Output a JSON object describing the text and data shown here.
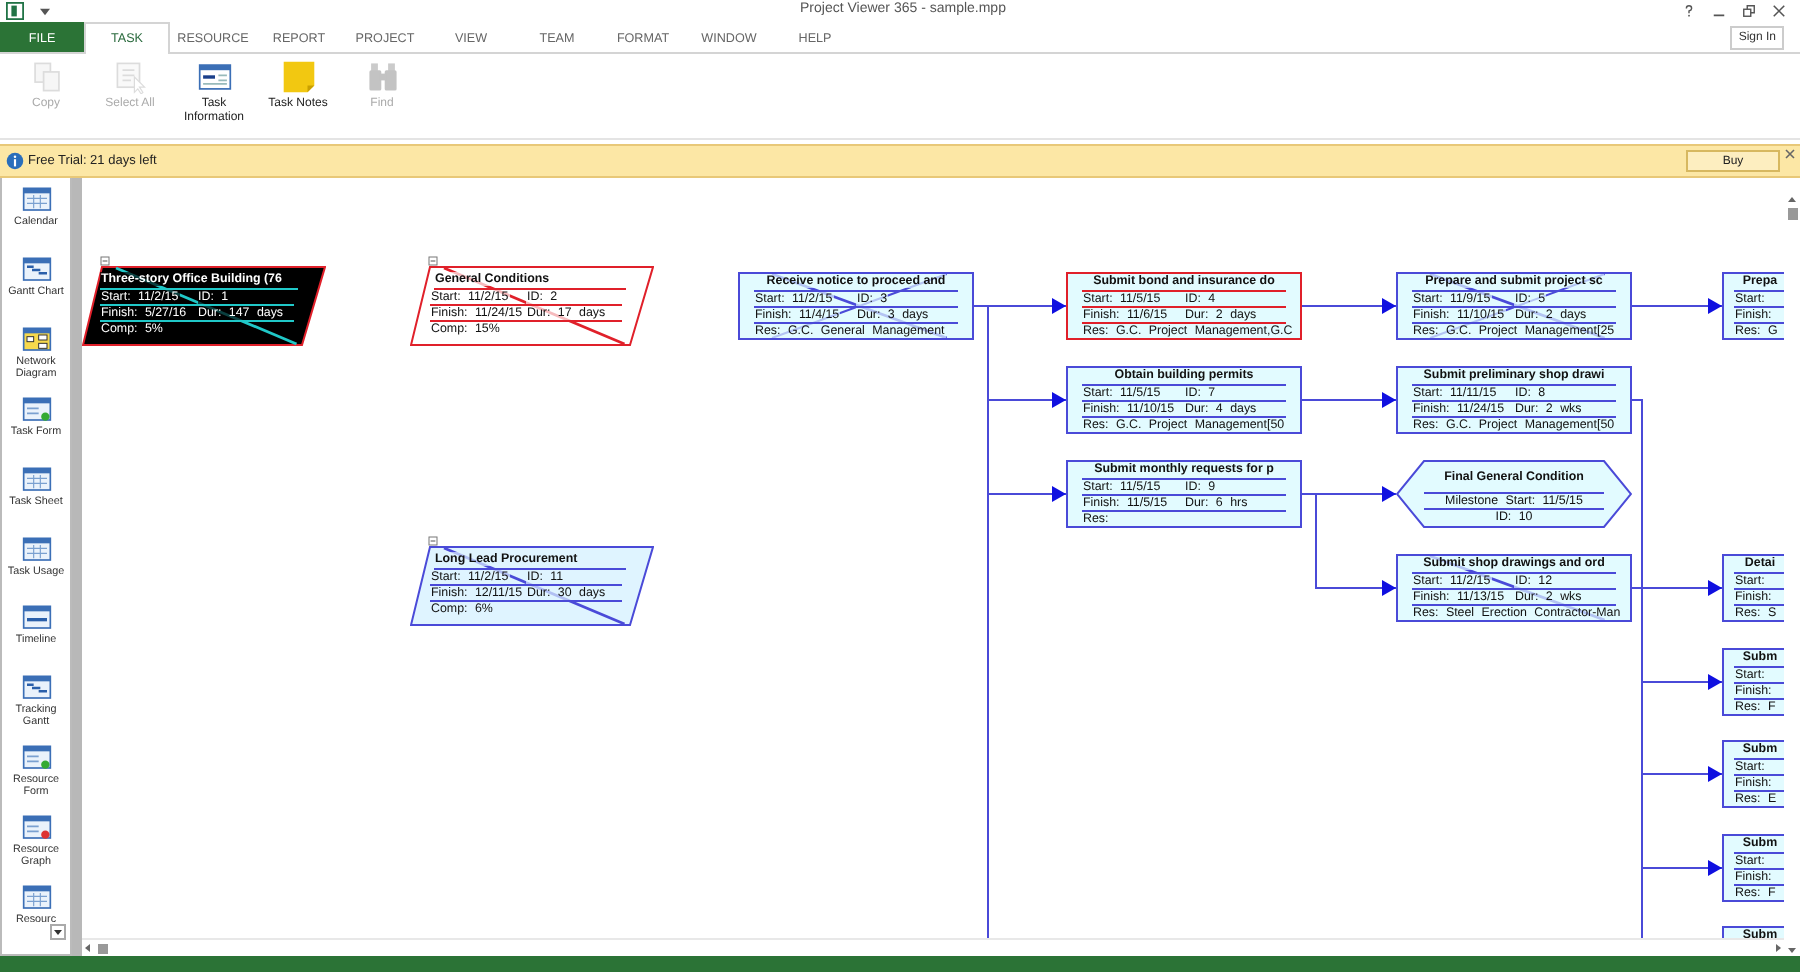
{
  "window": {
    "title": "Project Viewer 365 - sample.mpp"
  },
  "sign_in": "Sign In",
  "tabs": [
    {
      "label": "FILE",
      "kind": "file",
      "selected": false
    },
    {
      "label": "TASK",
      "kind": "tab",
      "selected": true
    },
    {
      "label": "RESOURCE",
      "kind": "tab",
      "selected": false
    },
    {
      "label": "REPORT",
      "kind": "tab",
      "selected": false
    },
    {
      "label": "PROJECT",
      "kind": "tab",
      "selected": false
    },
    {
      "label": "VIEW",
      "kind": "tab",
      "selected": false
    },
    {
      "label": "TEAM",
      "kind": "tab",
      "selected": false
    },
    {
      "label": "FORMAT",
      "kind": "tab",
      "selected": false
    },
    {
      "label": "WINDOW",
      "kind": "tab",
      "selected": false
    },
    {
      "label": "HELP",
      "kind": "tab",
      "selected": false
    }
  ],
  "ribbon": [
    {
      "label": "Copy",
      "disabled": true
    },
    {
      "label": "Select All",
      "disabled": true
    },
    {
      "label": "Task Information",
      "disabled": false
    },
    {
      "label": "Task Notes",
      "disabled": false
    },
    {
      "label": "Find",
      "disabled": true
    }
  ],
  "trial_bar": {
    "message": "Free Trial: 21 days left",
    "button": "Buy"
  },
  "views": [
    {
      "label": "Calendar",
      "selected": false
    },
    {
      "label": "Gantt Chart",
      "selected": false
    },
    {
      "label": "Network Diagram",
      "selected": true
    },
    {
      "label": "Task Form",
      "selected": false
    },
    {
      "label": "Task Sheet",
      "selected": false
    },
    {
      "label": "Task Usage",
      "selected": false
    },
    {
      "label": "Timeline",
      "selected": false
    },
    {
      "label": "Tracking Gantt",
      "selected": false
    },
    {
      "label": "Resource Form",
      "selected": false
    },
    {
      "label": "Resource Graph",
      "selected": false
    },
    {
      "label": "Resourc",
      "selected": false
    }
  ],
  "diagram": {
    "nodes": [
      {
        "kind": "summary",
        "title": "Three-story Office Building (76",
        "critical": true,
        "selected": true,
        "started": true,
        "finished": false,
        "rows": [
          [
            {
              "label": "Start:",
              "value": "11/2/15"
            },
            {
              "label": "ID:",
              "value": "1"
            }
          ],
          [
            {
              "label": "Finish:",
              "value": "5/27/16"
            },
            {
              "label": "Dur:",
              "value": "147 days"
            }
          ],
          [
            {
              "label": "Comp:",
              "value": "5%"
            }
          ]
        ]
      },
      {
        "kind": "summary",
        "title": "General Conditions",
        "critical": true,
        "selected": false,
        "started": true,
        "finished": false,
        "rows": [
          [
            {
              "label": "Start:",
              "value": "11/2/15"
            },
            {
              "label": "ID:",
              "value": "2"
            }
          ],
          [
            {
              "label": "Finish:",
              "value": "11/24/15"
            },
            {
              "label": "Dur:",
              "value": "17 days"
            }
          ],
          [
            {
              "label": "Comp:",
              "value": "15%"
            }
          ]
        ]
      },
      {
        "kind": "summary",
        "title": "Long Lead Procurement",
        "critical": false,
        "selected": false,
        "started": true,
        "finished": false,
        "rows": [
          [
            {
              "label": "Start:",
              "value": "11/2/15"
            },
            {
              "label": "ID:",
              "value": "11"
            }
          ],
          [
            {
              "label": "Finish:",
              "value": "12/11/15"
            },
            {
              "label": "Dur:",
              "value": "30 days"
            }
          ],
          [
            {
              "label": "Comp:",
              "value": "6%"
            }
          ]
        ]
      },
      {
        "kind": "task",
        "title": "Receive notice to proceed and",
        "critical": false,
        "selected": false,
        "started": true,
        "finished": true,
        "rows": [
          [
            {
              "label": "Start:",
              "value": "11/2/15"
            },
            {
              "label": "ID:",
              "value": "3"
            }
          ],
          [
            {
              "label": "Finish:",
              "value": "11/4/15"
            },
            {
              "label": "Dur:",
              "value": "3 days"
            }
          ],
          [
            {
              "label": "Res:",
              "value": "G.C. General Management"
            }
          ]
        ]
      },
      {
        "kind": "task",
        "title": "Submit bond and insurance do",
        "critical": true,
        "selected": false,
        "started": false,
        "finished": false,
        "rows": [
          [
            {
              "label": "Start:",
              "value": "11/5/15"
            },
            {
              "label": "ID:",
              "value": "4"
            }
          ],
          [
            {
              "label": "Finish:",
              "value": "11/6/15"
            },
            {
              "label": "Dur:",
              "value": "2 days"
            }
          ],
          [
            {
              "label": "Res:",
              "value": "G.C. Project Management,G.C"
            }
          ]
        ]
      },
      {
        "kind": "task",
        "title": "Obtain building permits",
        "critical": false,
        "selected": false,
        "started": false,
        "finished": false,
        "rows": [
          [
            {
              "label": "Start:",
              "value": "11/5/15"
            },
            {
              "label": "ID:",
              "value": "7"
            }
          ],
          [
            {
              "label": "Finish:",
              "value": "11/10/15"
            },
            {
              "label": "Dur:",
              "value": "4 days"
            }
          ],
          [
            {
              "label": "Res:",
              "value": "G.C. Project Management[50"
            }
          ]
        ]
      },
      {
        "kind": "task",
        "title": "Submit monthly requests for p",
        "critical": false,
        "selected": false,
        "started": false,
        "finished": false,
        "rows": [
          [
            {
              "label": "Start:",
              "value": "11/5/15"
            },
            {
              "label": "ID:",
              "value": "9"
            }
          ],
          [
            {
              "label": "Finish:",
              "value": "11/5/15"
            },
            {
              "label": "Dur:",
              "value": "6 hrs"
            }
          ],
          [
            {
              "label": "Res:"
            }
          ]
        ]
      },
      {
        "kind": "task",
        "title": "Prepare and submit project sc",
        "critical": false,
        "selected": false,
        "started": true,
        "finished": true,
        "rows": [
          [
            {
              "label": "Start:",
              "value": "11/9/15"
            },
            {
              "label": "ID:",
              "value": "5"
            }
          ],
          [
            {
              "label": "Finish:",
              "value": "11/10/15"
            },
            {
              "label": "Dur:",
              "value": "2 days"
            }
          ],
          [
            {
              "label": "Res:",
              "value": "G.C. Project Management[25"
            }
          ]
        ]
      },
      {
        "kind": "task",
        "title": "Submit preliminary shop drawi",
        "critical": false,
        "selected": false,
        "started": false,
        "finished": false,
        "rows": [
          [
            {
              "label": "Start:",
              "value": "11/11/15"
            },
            {
              "label": "ID:",
              "value": "8"
            }
          ],
          [
            {
              "label": "Finish:",
              "value": "11/24/15"
            },
            {
              "label": "Dur:",
              "value": "2 wks"
            }
          ],
          [
            {
              "label": "Res:",
              "value": "G.C. Project Management[50"
            }
          ]
        ]
      },
      {
        "kind": "milestone",
        "title": "Final General Condition",
        "critical": false,
        "selected": false,
        "rows": [
          [
            {
              "label": "Milestone Start:",
              "value": "11/5/15"
            }
          ],
          [
            {
              "label": "ID:",
              "value": "10"
            }
          ]
        ]
      },
      {
        "kind": "task",
        "title": "Submit shop drawings and ord",
        "critical": false,
        "selected": false,
        "started": true,
        "finished": false,
        "rows": [
          [
            {
              "label": "Start:",
              "value": "11/2/15"
            },
            {
              "label": "ID:",
              "value": "12"
            }
          ],
          [
            {
              "label": "Finish:",
              "value": "11/13/15"
            },
            {
              "label": "Dur:",
              "value": "2 wks"
            }
          ],
          [
            {
              "label": "Res:",
              "value": "Steel Erection Contractor-Man"
            }
          ]
        ]
      },
      {
        "kind": "task",
        "title": "Prepa",
        "critical": false,
        "selected": false,
        "rows": [
          [
            {
              "label": "Start:"
            }
          ],
          [
            {
              "label": "Finish:"
            }
          ],
          [
            {
              "label": "Res:",
              "value": "G"
            }
          ]
        ]
      },
      {
        "kind": "task",
        "title": "Detai",
        "critical": false,
        "selected": false,
        "rows": [
          [
            {
              "label": "Start:"
            }
          ],
          [
            {
              "label": "Finish:"
            }
          ],
          [
            {
              "label": "Res:",
              "value": "S"
            }
          ]
        ]
      },
      {
        "kind": "task",
        "title": "Subm",
        "critical": false,
        "selected": false,
        "rows": [
          [
            {
              "label": "Start:"
            }
          ],
          [
            {
              "label": "Finish:"
            }
          ],
          [
            {
              "label": "Res:",
              "value": "F"
            }
          ]
        ]
      },
      {
        "kind": "task",
        "title": "Subm",
        "critical": false,
        "selected": false,
        "rows": [
          [
            {
              "label": "Start:"
            }
          ],
          [
            {
              "label": "Finish:"
            }
          ],
          [
            {
              "label": "Res:",
              "value": "E"
            }
          ]
        ]
      },
      {
        "kind": "task",
        "title": "Subm",
        "critical": false,
        "selected": false,
        "rows": [
          [
            {
              "label": "Start:"
            }
          ],
          [
            {
              "label": "Finish:"
            }
          ],
          [
            {
              "label": "Res:",
              "value": "F"
            }
          ]
        ]
      },
      {
        "kind": "task",
        "title": "Subm",
        "critical": false,
        "selected": false
      }
    ]
  }
}
